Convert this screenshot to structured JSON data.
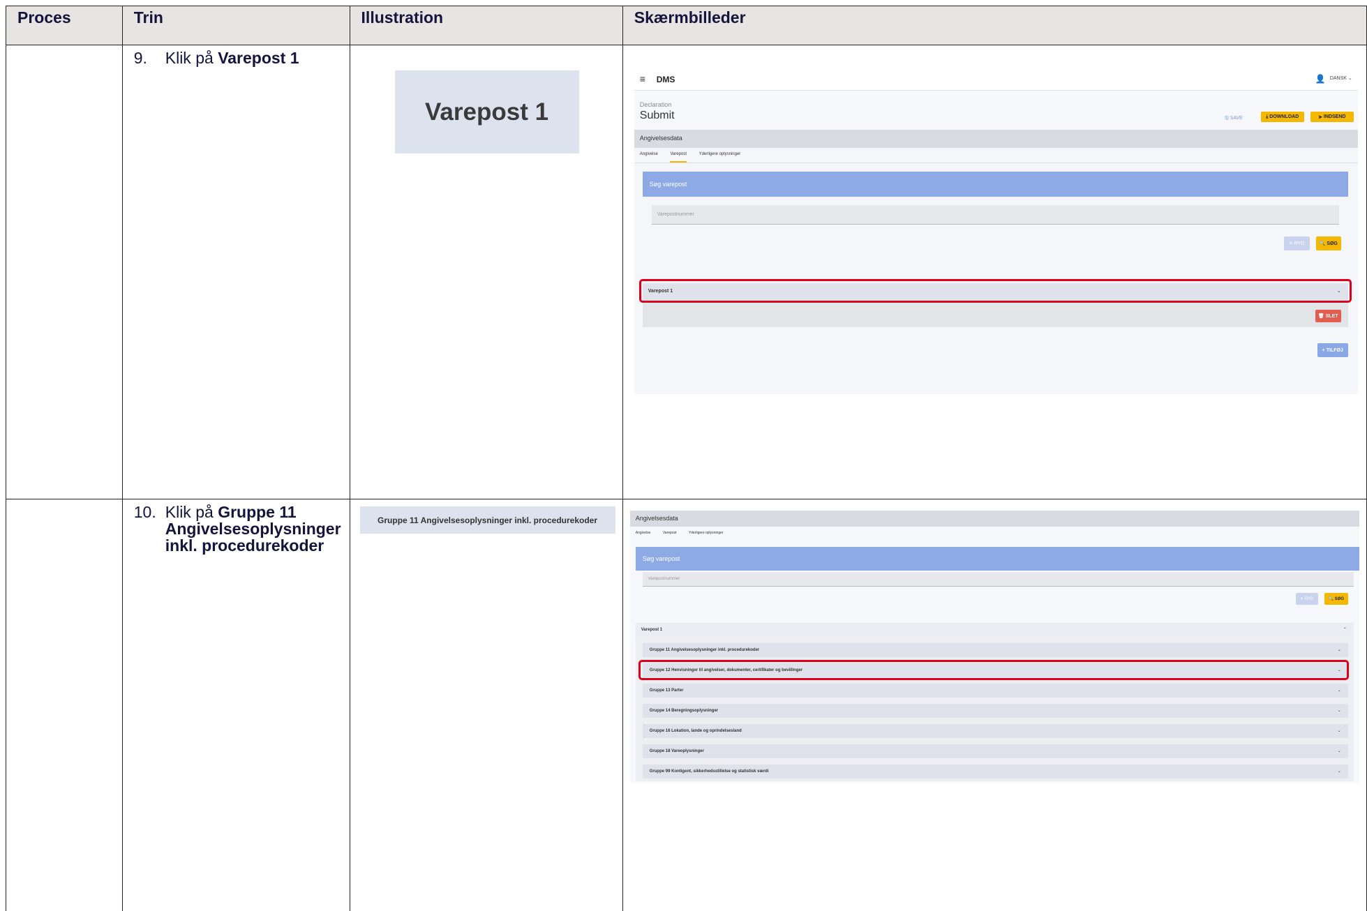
{
  "headers": [
    "Proces",
    "Trin",
    "Illustration",
    "Skærmbilleder"
  ],
  "rows": [
    {
      "step_num": "9.",
      "step_prefix": "Klik på ",
      "step_bold": "Varepost 1",
      "illustration": "Varepost 1",
      "screen": {
        "app_name": "DMS",
        "language": "DANSK",
        "breadcrumb": "Declaration",
        "page_title": "Submit",
        "save_label": "SAVE",
        "download_label": "DOWNLOAD",
        "submit_label": "INDSEND",
        "section_title": "Angivelsesdata",
        "tabs": [
          "Angivelse",
          "Varepost",
          "Yderligere oplysninger"
        ],
        "active_tab": "Varepost",
        "search_header": "Søg varepost",
        "search_placeholder": "Varepostnummer",
        "clear_label": "RYD",
        "search_label": "SØG",
        "item_label": "Varepost 1",
        "delete_label": "SLET",
        "add_label": "TILFØJ"
      }
    },
    {
      "step_num": "10.",
      "step_prefix": "Klik på ",
      "step_bold": "Gruppe 11 Angivelsesoplysninger inkl. procedurekoder",
      "illustration": "Gruppe 11 Angivelsesoplysninger inkl. procedurekoder",
      "screen": {
        "section_title": "Angivelsesdata",
        "tabs": [
          "Angivelse",
          "Varepost",
          "Yderligere oplysninger"
        ],
        "search_header": "Søg varepost",
        "search_placeholder": "Varepostnummer",
        "clear_label": "RYD",
        "search_label": "SØG",
        "item_label": "Varepost 1",
        "groups": [
          "Gruppe 11 Angivelsesoplysninger inkl. procedurekoder",
          "Gruppe 12 Henvisninger til angivelser, dokumenter, certifikater og bevillinger",
          "Gruppe 13 Parter",
          "Gruppe 14 Beregningsoplysninger",
          "Gruppe 16 Lokation, lande og oprindelsesland",
          "Gruppe 18 Vareoplysninger",
          "Gruppe 99 Kontigent, sikkerhedsstillelse og statistisk værdi"
        ]
      }
    }
  ],
  "colors": {
    "header_bg": "#e7e4e1",
    "highlight": "#e0001a",
    "accent_yellow": "#f5b800",
    "search_blue": "#8eaae6"
  }
}
